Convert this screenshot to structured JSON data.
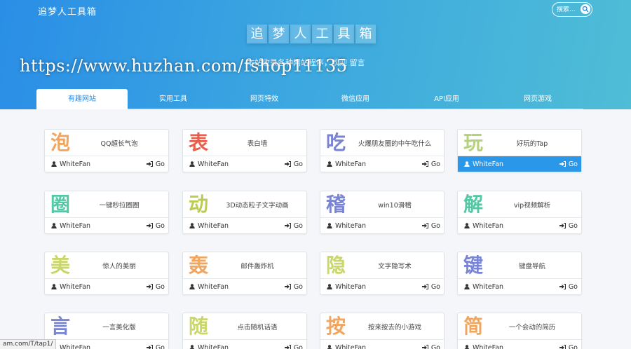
{
  "header": {
    "brand": "追梦人工具箱",
    "search_placeholder": "搜索...",
    "title_chars": [
      "追",
      "梦",
      "人",
      "工",
      "具",
      "箱"
    ],
    "subtitle": "本站收录各种网站程序，欢迎 留言",
    "watermark": "https://www.huzhan.com/fshop11135"
  },
  "tabs": [
    {
      "label": "有趣网站",
      "active": true
    },
    {
      "label": "实用工具",
      "active": false
    },
    {
      "label": "网页特效",
      "active": false
    },
    {
      "label": "微信应用",
      "active": false
    },
    {
      "label": "API应用",
      "active": false
    },
    {
      "label": "网页游戏",
      "active": false
    }
  ],
  "cards": [
    {
      "char": "泡",
      "color": "#f0a65e",
      "name": "QQ超长气泡",
      "author": "WhiteFan",
      "go": "Go",
      "highlight": false
    },
    {
      "char": "表",
      "color": "#e8604c",
      "name": "表白墙",
      "author": "WhiteFan",
      "go": "Go",
      "highlight": false
    },
    {
      "char": "吃",
      "color": "#7a84d4",
      "name": "火爆朋友圈的中午吃什么",
      "author": "WhiteFan",
      "go": "Go",
      "highlight": false
    },
    {
      "char": "玩",
      "color": "#b5d27a",
      "name": "好玩的Tap",
      "author": "WhiteFan",
      "go": "Go",
      "highlight": true
    },
    {
      "char": "圈",
      "color": "#55c7a4",
      "name": "一键秒拉圈圈",
      "author": "WhiteFan",
      "go": "Go",
      "highlight": false
    },
    {
      "char": "动",
      "color": "#bccb54",
      "name": "3D动态粒子文字动画",
      "author": "WhiteFan",
      "go": "Go",
      "highlight": false
    },
    {
      "char": "稽",
      "color": "#7a84d4",
      "name": "win10滑稽",
      "author": "WhiteFan",
      "go": "Go",
      "highlight": false
    },
    {
      "char": "解",
      "color": "#55c7a4",
      "name": "vip视频解析",
      "author": "WhiteFan",
      "go": "Go",
      "highlight": false
    },
    {
      "char": "美",
      "color": "#c9d66a",
      "name": "惊人的美丽",
      "author": "WhiteFan",
      "go": "Go",
      "highlight": false
    },
    {
      "char": "轰",
      "color": "#f0a65e",
      "name": "邮件轰炸机",
      "author": "WhiteFan",
      "go": "Go",
      "highlight": false
    },
    {
      "char": "隐",
      "color": "#c9d66a",
      "name": "文字隐写术",
      "author": "WhiteFan",
      "go": "Go",
      "highlight": false
    },
    {
      "char": "键",
      "color": "#7a84d4",
      "name": "键盘导航",
      "author": "WhiteFan",
      "go": "Go",
      "highlight": false
    },
    {
      "char": "言",
      "color": "#7a84d4",
      "name": "一言美化版",
      "author": "WhiteFan",
      "go": "Go",
      "highlight": false
    },
    {
      "char": "随",
      "color": "#c9d66a",
      "name": "点击随机话语",
      "author": "WhiteFan",
      "go": "Go",
      "highlight": false
    },
    {
      "char": "按",
      "color": "#f0a65e",
      "name": "按来按去的小游戏",
      "author": "WhiteFan",
      "go": "Go",
      "highlight": false
    },
    {
      "char": "简",
      "color": "#f0a65e",
      "name": "一个会动的简历",
      "author": "WhiteFan",
      "go": "Go",
      "highlight": false
    }
  ],
  "status_bar": "am.com/T/tap1/"
}
